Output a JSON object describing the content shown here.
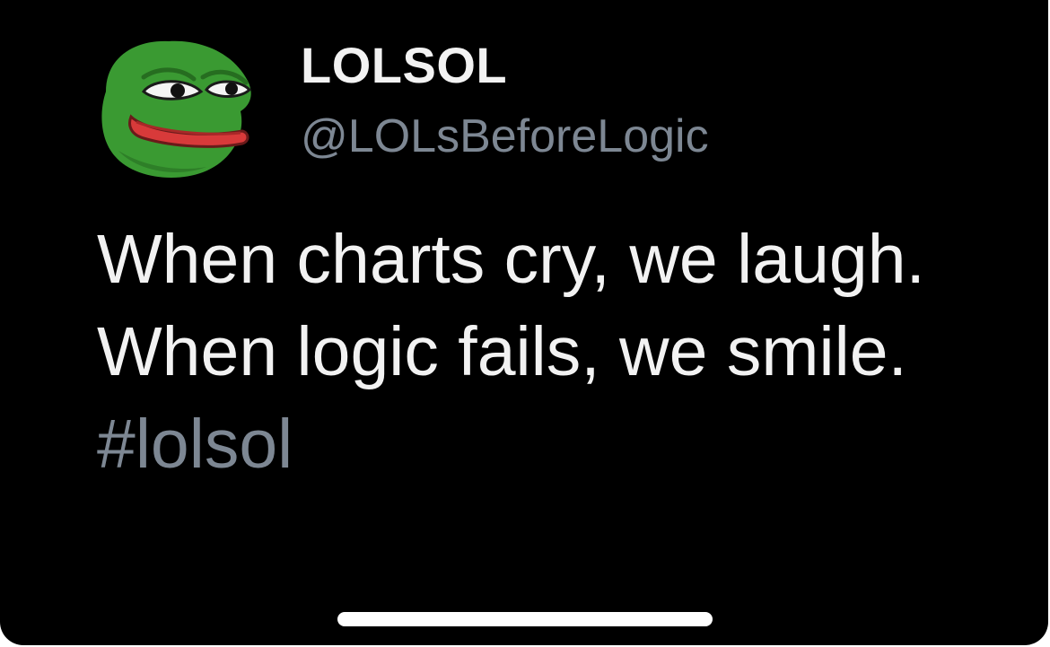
{
  "author": {
    "display_name": "LOLSOL",
    "handle": "@LOLsBeforeLogic",
    "avatar_icon": "pepe-frog-avatar-icon"
  },
  "tweet": {
    "lines": [
      "When charts cry, we laugh.",
      "When logic fails, we smile."
    ],
    "hashtag": "#lolsol"
  },
  "colors": {
    "background": "#000000",
    "primary_text": "#f2f2f2",
    "secondary_text": "#7d8793",
    "avatar_green": "#3a9a32",
    "mouth_red": "#d83a3a"
  }
}
